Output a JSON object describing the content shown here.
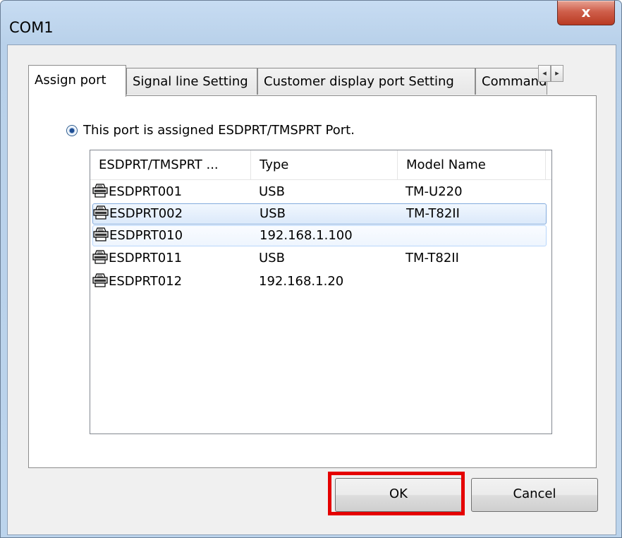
{
  "window": {
    "title": "COM1",
    "close_glyph": "x"
  },
  "tabs": [
    {
      "label": "Assign port",
      "active": true
    },
    {
      "label": "Signal line Setting",
      "active": false
    },
    {
      "label": "Customer display port Setting",
      "active": false
    },
    {
      "label": "Command I",
      "active": false
    }
  ],
  "tab_scroll": {
    "left": "◂",
    "right": "▸"
  },
  "radio": {
    "label": "This port is assigned ESDPRT/TMSPRT Port.",
    "checked": true
  },
  "list": {
    "columns": [
      "ESDPRT/TMSPRT ...",
      "Type",
      "Model Name"
    ],
    "rows": [
      {
        "port": "ESDPRT001",
        "type": "USB",
        "model": "TM-U220",
        "state": "normal"
      },
      {
        "port": "ESDPRT002",
        "type": "USB",
        "model": "TM-T82II",
        "state": "selected"
      },
      {
        "port": "ESDPRT010",
        "type": "192.168.1.100",
        "model": "",
        "state": "hover"
      },
      {
        "port": "ESDPRT011",
        "type": "USB",
        "model": "TM-T82II",
        "state": "normal"
      },
      {
        "port": "ESDPRT012",
        "type": "192.168.1.20",
        "model": "",
        "state": "normal"
      }
    ],
    "row_icon": "printer-icon"
  },
  "buttons": {
    "ok": "OK",
    "cancel": "Cancel"
  },
  "colors": {
    "highlight_frame": "#e50000",
    "close_button": "#c9503a",
    "selection_border": "#84acdd"
  }
}
